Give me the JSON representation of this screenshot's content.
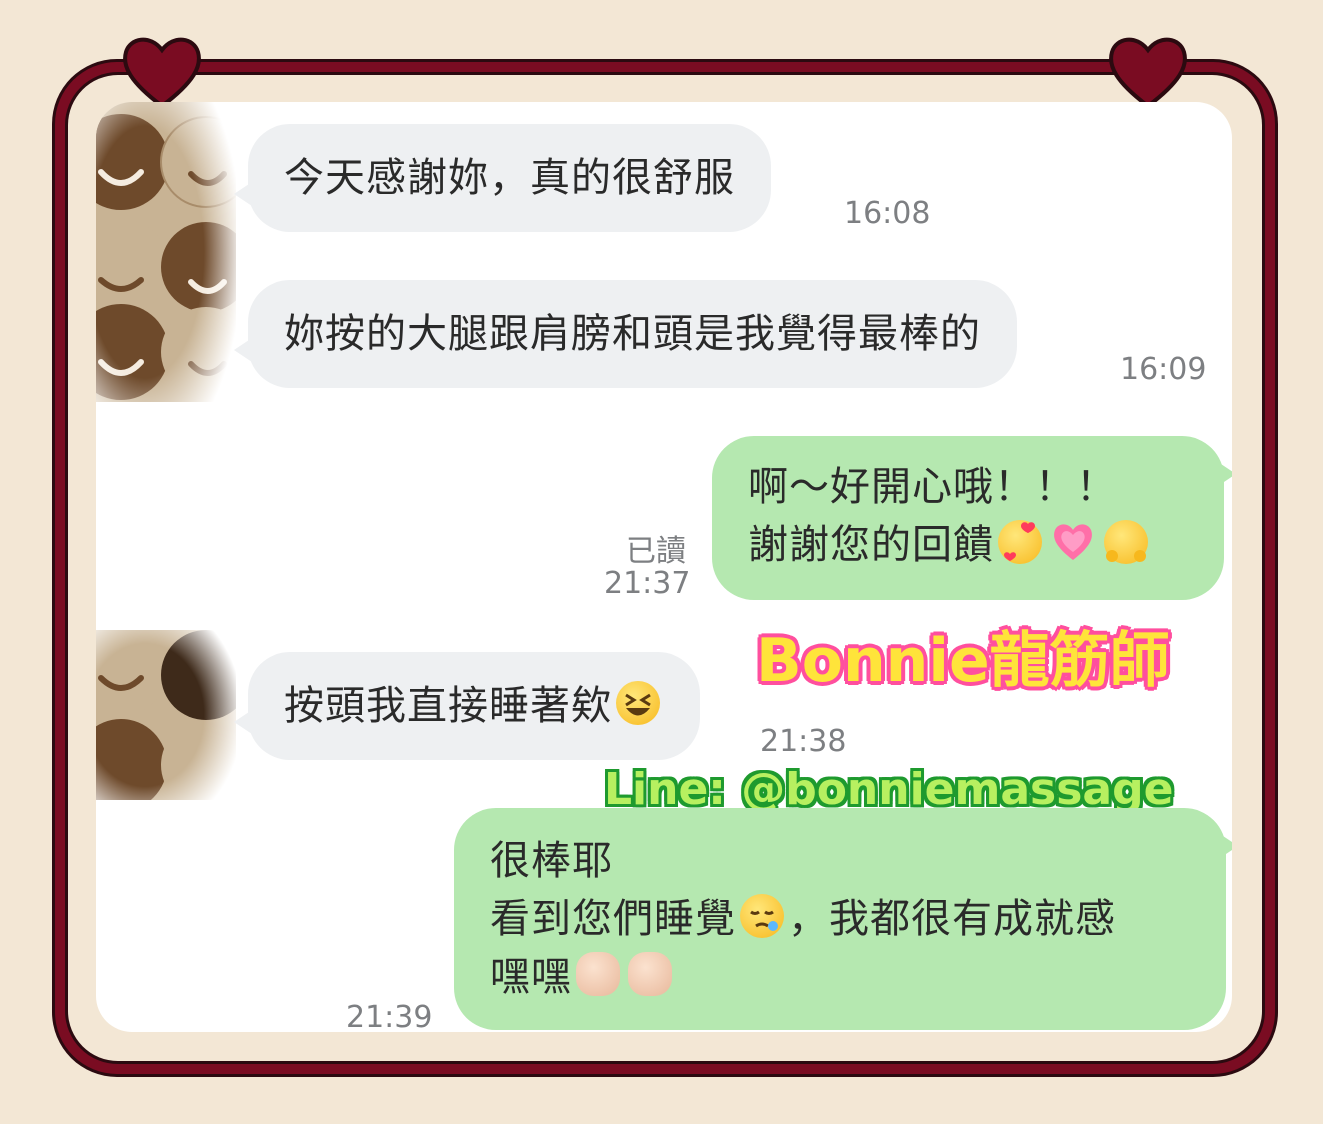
{
  "messages": [
    {
      "side": "in",
      "lines": [
        "今天感謝妳，真的很舒服"
      ],
      "time": "16:08"
    },
    {
      "side": "in",
      "lines": [
        "妳按的大腿跟肩膀和頭是我覺得最棒的"
      ],
      "time": "16:09"
    },
    {
      "side": "out",
      "lines": [
        "啊～好開心哦！！！",
        "謝謝您的回饋"
      ],
      "emojis": [
        "smiling-face-with-hearts",
        "growing-heart",
        "hugging-face"
      ],
      "read": "已讀",
      "time": "21:37"
    },
    {
      "side": "in",
      "lines": [
        "按頭我直接睡著欸"
      ],
      "emojis": [
        "grinning-squinting-face"
      ],
      "time": "21:38"
    },
    {
      "side": "out",
      "lines": [
        "很棒耶",
        "看到您們睡覺",
        "，我都很有成就感",
        "嘿嘿"
      ],
      "emojis": [
        "sleepy-face",
        "thumbs-up",
        "flexed-biceps"
      ],
      "time": "21:39"
    }
  ],
  "watermark": {
    "brand": "Bonnie龍筋師",
    "line_id": "Line: @bonniemassage"
  },
  "colors": {
    "frame": "#7a0c22",
    "background": "#f3e7d5",
    "incoming_bubble": "#eef0f2",
    "outgoing_bubble": "#b5e8b0",
    "brand_text": "#ffe43a",
    "brand_outline": "#ff4f9e",
    "line_text": "#b7f060",
    "line_outline": "#1e9a2e"
  }
}
